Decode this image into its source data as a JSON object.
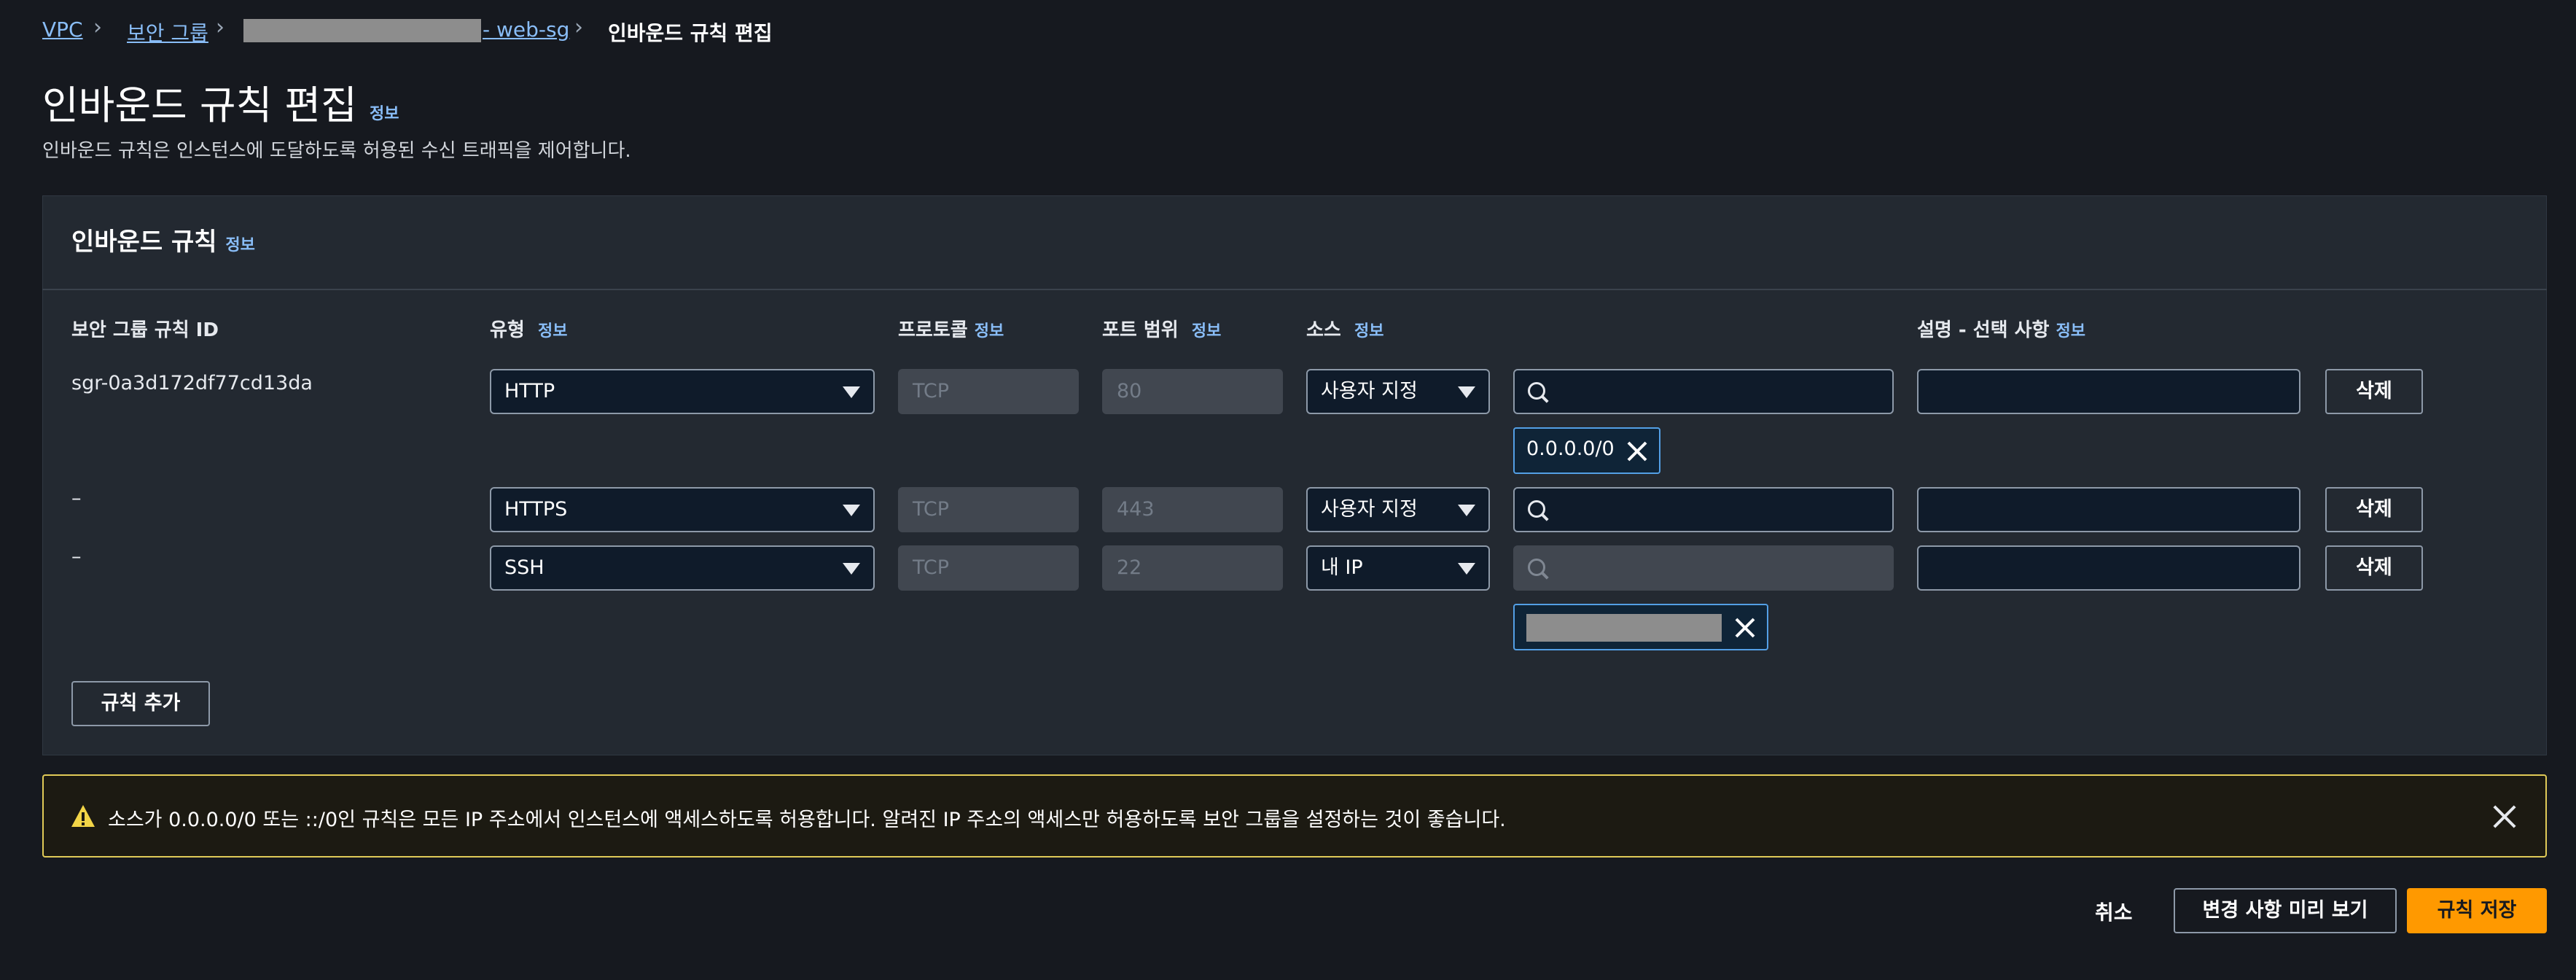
{
  "breadcrumb": {
    "vpc": "VPC",
    "security_groups": "보안 그룹",
    "sg_name_suffix": "- web-sg",
    "current": "인바운드 규칙 편집"
  },
  "page": {
    "title": "인바운드 규칙 편집",
    "info": "정보",
    "description": "인바운드 규칙은 인스턴스에 도달하도록 허용된 수신 트래픽을 제어합니다."
  },
  "panel": {
    "title": "인바운드 규칙",
    "info": "정보",
    "columns": {
      "rule_id": "보안 그룹 규칙 ID",
      "type": "유형",
      "protocol": "프로토콜",
      "port_range": "포트 범위",
      "source": "소스",
      "description": "설명 - 선택 사항",
      "info": "정보"
    },
    "rows": [
      {
        "rule_id": "sgr-0a3d172df77cd13da",
        "type": "HTTP",
        "protocol": "TCP",
        "port": "80",
        "source": "사용자 지정",
        "token": "0.0.0.0/0",
        "delete": "삭제"
      },
      {
        "rule_id": "–",
        "type": "HTTPS",
        "protocol": "TCP",
        "port": "443",
        "source": "사용자 지정",
        "delete": "삭제"
      },
      {
        "rule_id": "–",
        "type": "SSH",
        "protocol": "TCP",
        "port": "22",
        "source": "내 IP",
        "delete": "삭제"
      }
    ],
    "add_rule": "규칙 추가"
  },
  "alert": {
    "text": "소스가 0.0.0.0/0 또는 ::/0인 규칙은 모든 IP 주소에서 인스턴스에 액세스하도록 허용합니다. 알려진 IP 주소의 액세스만 허용하도록 보안 그룹을 설정하는 것이 좋습니다."
  },
  "footer": {
    "cancel": "취소",
    "preview": "변경 사항 미리 보기",
    "save": "규칙 저장"
  },
  "colors": {
    "accent": "#ff9900",
    "link": "#89bdf7",
    "warning": "#e0ca57"
  }
}
